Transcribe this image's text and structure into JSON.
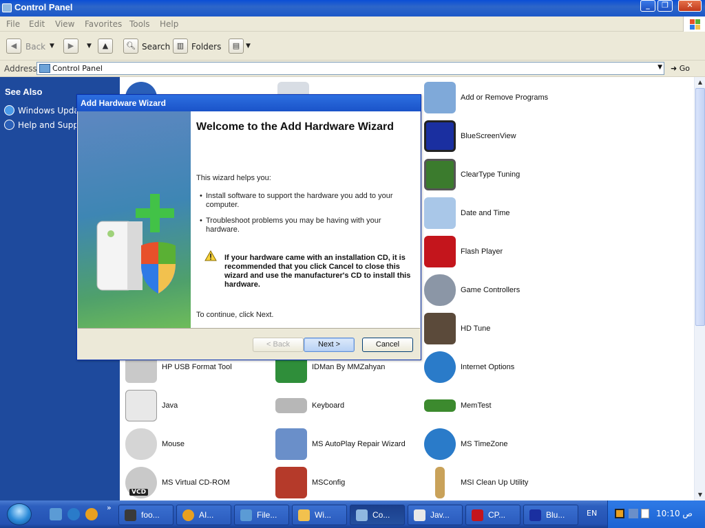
{
  "window": {
    "title": "Control Panel",
    "controls": {
      "minimize": "_",
      "maximize": "❐",
      "close": "✕"
    }
  },
  "menu": [
    "File",
    "Edit",
    "View",
    "Favorites",
    "Tools",
    "Help"
  ],
  "toolbar": {
    "back_label": "Back",
    "search_label": "Search",
    "folders_label": "Folders"
  },
  "address": {
    "label": "Address",
    "value": "Control Panel",
    "go_label": "Go"
  },
  "taskpane": {
    "heading": "See Also",
    "links": [
      "Windows Update",
      "Help and Support"
    ]
  },
  "items": [
    {
      "name": "Add or Remove Programs",
      "icon": "add-remove-programs-icon",
      "color": "#7fa9d9"
    },
    {
      "name": "BlueScreenView",
      "icon": "bluescreen-monitor-icon",
      "color": "#1a2fa0"
    },
    {
      "name": "ClearType Tuning",
      "icon": "cleartype-icon",
      "color": "#3b7b2d"
    },
    {
      "name": "Date and Time",
      "icon": "date-time-icon",
      "color": "#a9c7e8"
    },
    {
      "name": "Flash Player",
      "icon": "flash-player-icon",
      "color": "#c4151c"
    },
    {
      "name": "Game Controllers",
      "icon": "game-controller-icon",
      "color": "#8b96a6"
    },
    {
      "name": "HD Tune",
      "icon": "hd-tune-icon",
      "color": "#5b4a3a"
    },
    {
      "name": "HP USB Format Tool",
      "icon": "usb-drive-icon",
      "color": "#c9c9c9"
    },
    {
      "name": "IDMan By MMZahyan",
      "icon": "idman-icon",
      "color": "#2f8e3a"
    },
    {
      "name": "Internet Options",
      "icon": "internet-options-icon",
      "color": "#2a7bc9"
    },
    {
      "name": "Java",
      "icon": "java-icon",
      "color": "#e8e8e8"
    },
    {
      "name": "Keyboard",
      "icon": "keyboard-icon",
      "color": "#b7b7b7"
    },
    {
      "name": "MemTest",
      "icon": "memory-module-icon",
      "color": "#3c8a2e"
    },
    {
      "name": "Mouse",
      "icon": "mouse-icon",
      "color": "#d5d5d5"
    },
    {
      "name": "MS AutoPlay Repair Wizard",
      "icon": "autoplay-repair-icon",
      "color": "#6a8fc9"
    },
    {
      "name": "MS TimeZone",
      "icon": "timezone-globe-icon",
      "color": "#2a7bc9"
    },
    {
      "name": "MS Virtual CD-ROM",
      "icon": "virtual-cdrom-icon",
      "color": "#c9c9c9"
    },
    {
      "name": "MSConfig",
      "icon": "msconfig-icon",
      "color": "#b53a2a"
    },
    {
      "name": "MSI Clean Up Utility",
      "icon": "broom-icon",
      "color": "#c9a25a"
    }
  ],
  "vcd_badge": "VCD",
  "dialog": {
    "title": "Add Hardware Wizard",
    "heading": "Welcome to the Add Hardware Wizard",
    "intro": "This wizard helps you:",
    "bullets": [
      "Install software to support the hardware you add to your computer.",
      "Troubleshoot problems you may be having with your hardware."
    ],
    "warning": "If your hardware came with an installation CD, it is recommended that you click Cancel to close this wizard and use the manufacturer's CD to install this hardware.",
    "continue_text": "To continue, click Next.",
    "buttons": {
      "back": "< Back",
      "next": "Next >",
      "cancel": "Cancel"
    }
  },
  "taskbar": {
    "tasks": [
      {
        "label": "foo...",
        "icon": "alien-icon",
        "color": "#3a3a3a"
      },
      {
        "label": "AI...",
        "icon": "aimp-icon",
        "color": "#e8a020"
      },
      {
        "label": "File...",
        "icon": "file-manager-icon",
        "color": "#5b9bd5"
      },
      {
        "label": "Wi...",
        "icon": "windows-icon",
        "color": "#f2c14e"
      },
      {
        "label": "Co...",
        "icon": "control-panel-icon",
        "color": "#8fb8e0"
      },
      {
        "label": "Jav...",
        "icon": "java-icon",
        "color": "#e8e8e8"
      },
      {
        "label": "CP...",
        "icon": "cpu-h-icon",
        "color": "#c4151c"
      },
      {
        "label": "Blu...",
        "icon": "bluescreen-icon",
        "color": "#1a2fa0"
      }
    ],
    "language": "EN",
    "clock": "10:10 ص"
  }
}
